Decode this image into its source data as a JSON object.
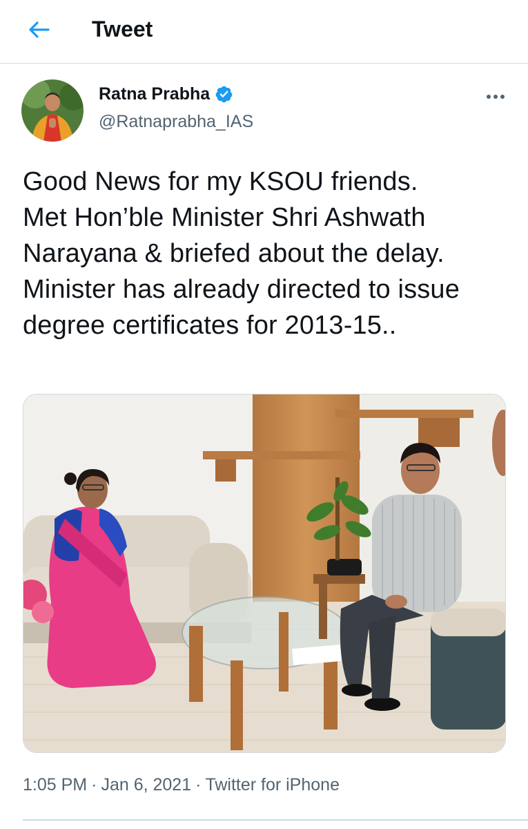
{
  "header": {
    "back_icon": "back-arrow-icon",
    "title": "Tweet"
  },
  "tweet": {
    "author": {
      "display_name": "Ratna Prabha",
      "handle": "@Ratnaprabha_IAS",
      "verified_icon": "verified-badge-icon"
    },
    "more_icon": "more-options-icon",
    "text": "Good News for my KSOU friends.\nMet Hon’ble Minister Shri Ashwath Narayana & briefed about the delay.\nMinister has already  directed to issue degree certificates for 2013-15..",
    "meta": {
      "time": "1:05 PM",
      "date": "Jan 6, 2021",
      "source": "Twitter for iPhone",
      "separator": "·"
    }
  },
  "colors": {
    "accent": "#1d9bf0",
    "text": "#0f1419",
    "secondary": "#536471",
    "border": "#cfd9de"
  }
}
